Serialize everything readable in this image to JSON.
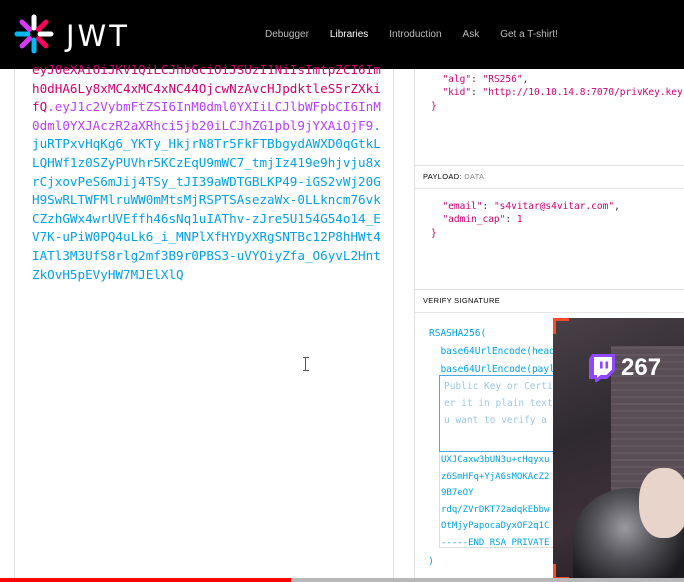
{
  "brand": {
    "logo_text": "JWT"
  },
  "nav": {
    "items": [
      {
        "label": "Debugger",
        "active": false
      },
      {
        "label": "Libraries",
        "active": true
      },
      {
        "label": "Introduction",
        "active": false
      },
      {
        "label": "Ask",
        "active": false
      },
      {
        "label": "Get a T-shirt!",
        "active": false
      }
    ]
  },
  "encoded": {
    "header_part": "eyJ0eXAiOiJKV1QiLCJhbGciOiJSUzI1NiIsImtpZCI6Imh0dHA6Ly8xMC4xMC4xNC44OjcwNzAvcHJpdktleS5rZXkifQ",
    "payload_part": "eyJ1c2VybmFtZSI6InM0dml0YXIiLCJlbWFpbCI6InM0dml0YXJAczR2aXRhci5jb20iLCJhZG1pbl9jYXAiOjF9",
    "signature_part": "juRTPxvHqKg6_YKTy_HkjrN8Tr5FkFTBbgydAWXD0qGtkLLQHWf1z0SZyPUVhr5KCzEqU9mWC7_tmjIz419e9hjvju8xrCjxovPeS6mJij4TSy_tJI39aWDTGBLKP49-iGS2vWj20GH9SwRLTWFMlruWW0mMtsMjRSPTSAsezaWx-0LLkncm76vkCZzhGWx4wrUVEffh46sNq1uIAThv-zJre5U154G54o14_EV7K-uPiW0PQ4uLk6_i_MNPlXfHYDyXRgSNTBc12P8hHWt4IATl3M3UfS8rlg2mf3B9r0PBS3-uVYOiyZfa_O6yvL2HntZkOvH5pEVyHW7MJElXlQ"
  },
  "header_section": {
    "lines": {
      "alg_key": "\"alg\"",
      "alg_val": "\"RS256\"",
      "kid_key": "\"kid\"",
      "kid_val": "\"http://10.10.14.8:7070/privKey.key\""
    }
  },
  "payload_section": {
    "label": "PAYLOAD:",
    "sublabel": "DATA",
    "lines": {
      "email_key": "\"email\"",
      "email_val": "\"s4vitar@s4vitar.com\"",
      "cap_key": "\"admin_cap\"",
      "cap_val": "1"
    }
  },
  "verify_section": {
    "label": "VERIFY SIGNATURE",
    "line1": "RSASHA256(",
    "line2": "  base64UrlEncode(head",
    "line3": "  base64UrlEncode(payl",
    "textarea_placeholder": "Public Key or Certi\ner it in plain text\nu want to verify a t",
    "pubkey_lines": [
      "UXJCaxw3bUN3u+cHqyxu",
      "z6SmHFq+YjA6sMOKAcZ2",
      "9B7eOY",
      "rdq/ZVrDKT72adqkEbbw",
      "OtMjyPapocaDyxOF2q1C",
      "-----END RSA PRIVATE"
    ],
    "closing": ")"
  },
  "webcam": {
    "viewer_count": "267"
  },
  "video": {
    "progress_fraction": 0.425
  },
  "colors": {
    "header_token": "#d0006f",
    "payload_token": "#b540ff",
    "signature_token": "#00a1e6",
    "progress": "#ff0000"
  }
}
